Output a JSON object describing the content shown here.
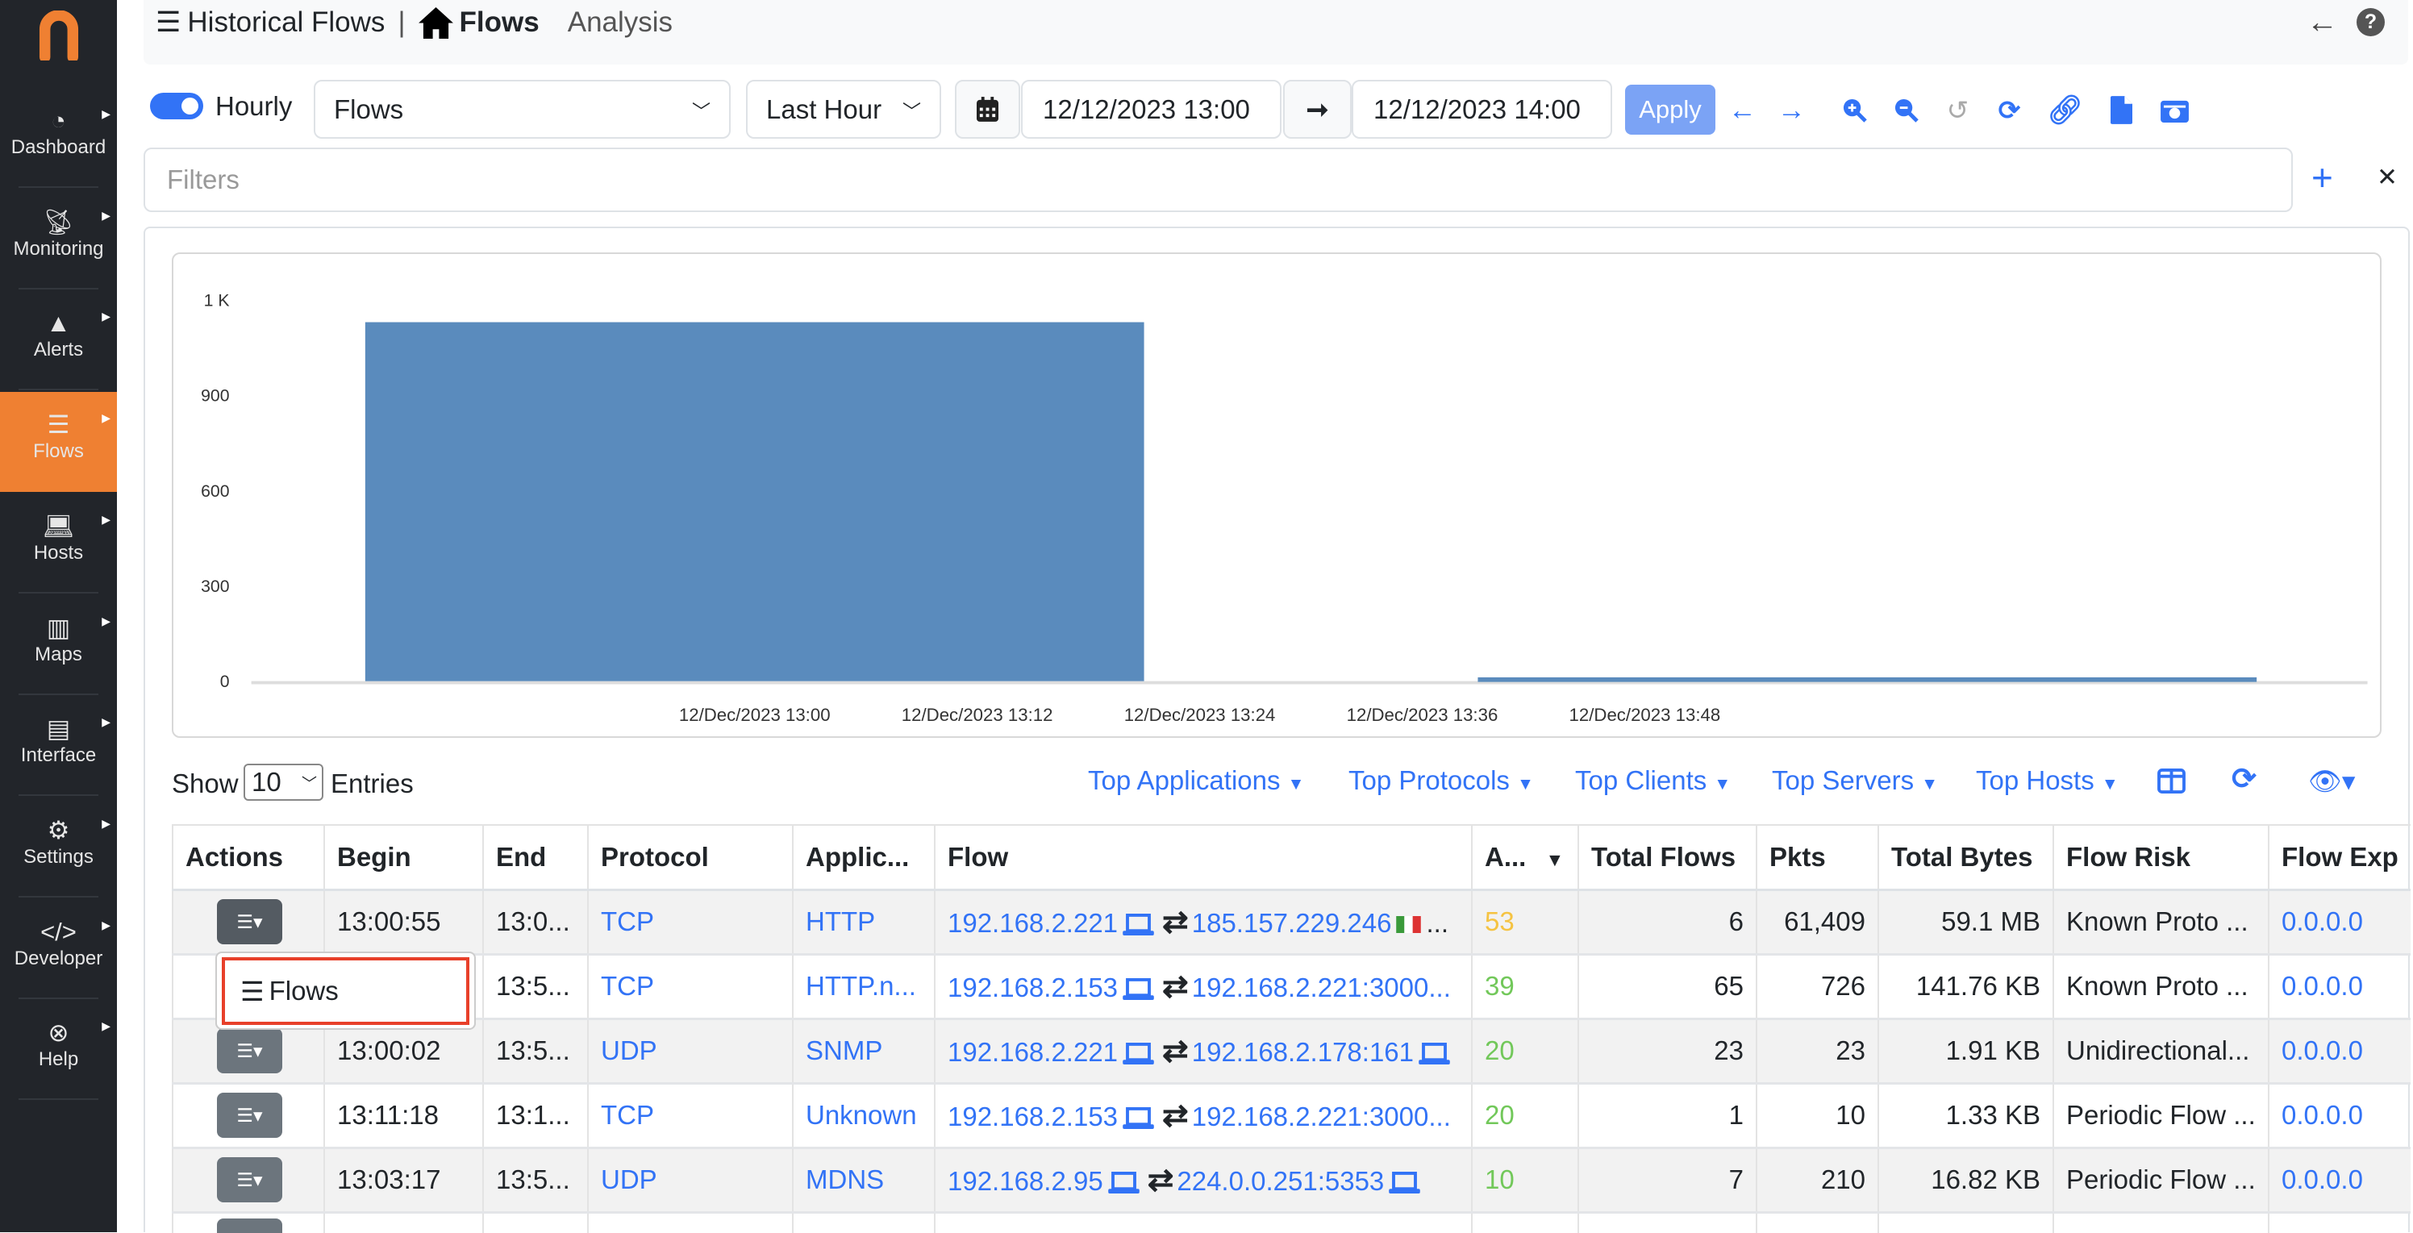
{
  "sidebar": {
    "items": [
      {
        "label": "Dashboard",
        "icon": "gauge-icon"
      },
      {
        "label": "Monitoring",
        "icon": "satellite-dish-icon"
      },
      {
        "label": "Alerts",
        "icon": "warning-icon"
      },
      {
        "label": "Flows",
        "icon": "bars-icon",
        "active": true
      },
      {
        "label": "Hosts",
        "icon": "laptop-icon"
      },
      {
        "label": "Maps",
        "icon": "map-icon"
      },
      {
        "label": "Interface",
        "icon": "ethernet-icon"
      },
      {
        "label": "Settings",
        "icon": "gear-icon"
      },
      {
        "label": "Developer",
        "icon": "code-icon"
      },
      {
        "label": "Help",
        "icon": "life-ring-icon"
      }
    ],
    "accent": "#ef8032"
  },
  "header": {
    "title": "Historical Flows",
    "separator": "|",
    "active_tab": "Flows",
    "tab2": "Analysis"
  },
  "toolbar": {
    "hourly_label": "Hourly",
    "hourly_on": true,
    "source_select": "Flows",
    "range_select": "Last Hour",
    "begin": "12/12/2023 13:00",
    "end": "12/12/2023 14:00",
    "apply": "Apply"
  },
  "filters": {
    "placeholder": "Filters"
  },
  "chart_data": {
    "type": "bar",
    "ylim": [
      0,
      1200
    ],
    "yticks": [
      {
        "v": 0,
        "label": "0"
      },
      {
        "v": 300,
        "label": "300"
      },
      {
        "v": 600,
        "label": "600"
      },
      {
        "v": 900,
        "label": "900"
      },
      {
        "v": 1200,
        "label": "1 K"
      }
    ],
    "xticks": [
      "12/Dec/2023 13:00",
      "12/Dec/2023 13:12",
      "12/Dec/2023 13:24",
      "12/Dec/2023 13:36",
      "12/Dec/2023 13:48"
    ],
    "x": [
      "12/Dec/2023 13:00",
      "12/Dec/2023 14:00"
    ],
    "values": [
      1130,
      12
    ],
    "color": "#5a8bbd",
    "grid": false
  },
  "table_controls": {
    "show": "Show",
    "entries_value": "10",
    "entries": "Entries",
    "dropdowns": [
      "Top Applications",
      "Top Protocols",
      "Top Clients",
      "Top Servers",
      "Top Hosts"
    ]
  },
  "table": {
    "columns": [
      "Actions",
      "Begin",
      "End",
      "Protocol",
      "Applic...",
      "Flow",
      "A...",
      "Total Flows",
      "Pkts",
      "Total Bytes",
      "Flow Risk",
      "Flow Exp"
    ],
    "rows": [
      {
        "begin": "13:00:55",
        "end": "13:0...",
        "proto": "TCP",
        "app": "HTTP",
        "src": "192.168.2.221",
        "dst": "185.157.229.246",
        "dst_icon": "italy-flag-icon",
        "more": "...",
        "score": "53",
        "score_color": "#f5c342",
        "flows": "6",
        "pkts": "61,409",
        "bytes": "59.1 MB",
        "risk": "Known Proto ...",
        "exp": "0.0.0.0"
      },
      {
        "begin": "",
        "end": "13:5...",
        "proto": "TCP",
        "app": "HTTP.n...",
        "src": "192.168.2.153",
        "dst": "192.168.2.221:3000...",
        "dst_icon": "",
        "more": "",
        "score": "39",
        "score_color": "#72c85a",
        "flows": "65",
        "pkts": "726",
        "bytes": "141.76 KB",
        "risk": "Known Proto ...",
        "exp": "0.0.0.0"
      },
      {
        "begin": "13:00:02",
        "end": "13:5...",
        "proto": "UDP",
        "app": "SNMP",
        "src": "192.168.2.221",
        "dst": "192.168.2.178:161",
        "dst_icon": "laptop-icon",
        "more": "",
        "score": "20",
        "score_color": "#72c85a",
        "flows": "23",
        "pkts": "23",
        "bytes": "1.91 KB",
        "risk": "Unidirectional...",
        "exp": "0.0.0.0"
      },
      {
        "begin": "13:11:18",
        "end": "13:1...",
        "proto": "TCP",
        "app": "Unknown",
        "src": "192.168.2.153",
        "dst": "192.168.2.221:3000...",
        "dst_icon": "",
        "more": "",
        "score": "20",
        "score_color": "#72c85a",
        "flows": "1",
        "pkts": "10",
        "bytes": "1.33 KB",
        "risk": "Periodic Flow ...",
        "exp": "0.0.0.0"
      },
      {
        "begin": "13:03:17",
        "end": "13:5...",
        "proto": "UDP",
        "app": "MDNS",
        "src": "192.168.2.95",
        "dst": "224.0.0.251:5353",
        "dst_icon": "laptop-icon",
        "more": "",
        "score": "10",
        "score_color": "#72c85a",
        "flows": "7",
        "pkts": "210",
        "bytes": "16.82 KB",
        "risk": "Periodic Flow ...",
        "exp": "0.0.0.0"
      },
      {
        "begin": "",
        "end": "",
        "proto": "",
        "app": "",
        "src": "",
        "dst": "",
        "dst_icon": "",
        "more": "",
        "score": "",
        "score_color": "#72c85a",
        "flows": "",
        "pkts": "",
        "bytes": "",
        "risk": "",
        "exp": ""
      }
    ]
  },
  "action_menu": {
    "item": "Flows"
  }
}
